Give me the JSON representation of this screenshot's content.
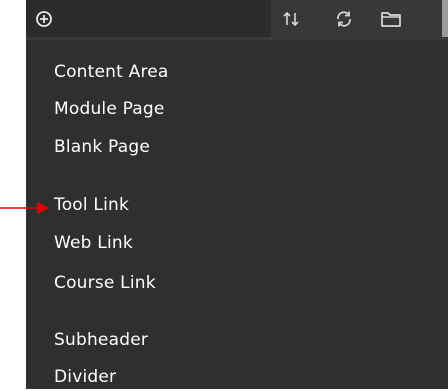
{
  "toolbar": {
    "add_icon": "plus-circle-icon",
    "reorder_icon": "reorder-arrows-icon",
    "refresh_icon": "refresh-icon",
    "folder_icon": "folder-icon"
  },
  "menu": {
    "items": [
      {
        "label": "Content Area"
      },
      {
        "label": "Module Page"
      },
      {
        "label": "Blank Page"
      },
      {
        "label": "Tool Link"
      },
      {
        "label": "Web Link"
      },
      {
        "label": "Course Link"
      },
      {
        "label": "Subheader"
      },
      {
        "label": "Divider"
      }
    ]
  },
  "colors": {
    "background": "#2f2f2f",
    "text": "#ffffff",
    "annotation_arrow": "#e00000"
  }
}
